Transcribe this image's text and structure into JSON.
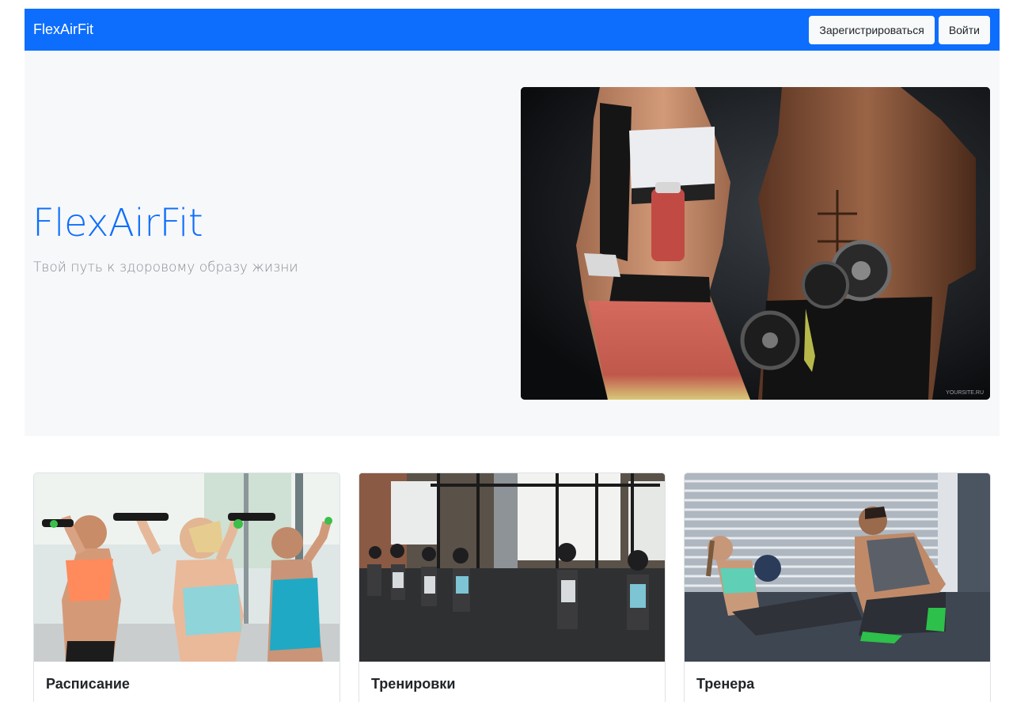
{
  "navbar": {
    "brand": "FlexAirFit",
    "register_label": "Зарегистрироваться",
    "login_label": "Войти",
    "color": "#0d6efd"
  },
  "hero": {
    "title": "FlexAirFit",
    "subtitle": "Твой путь к здоровому образу жизни",
    "image_watermark": "YOURSITE.RU"
  },
  "cards": [
    {
      "title": "Расписание"
    },
    {
      "title": "Тренировки"
    },
    {
      "title": "Тренера"
    }
  ]
}
